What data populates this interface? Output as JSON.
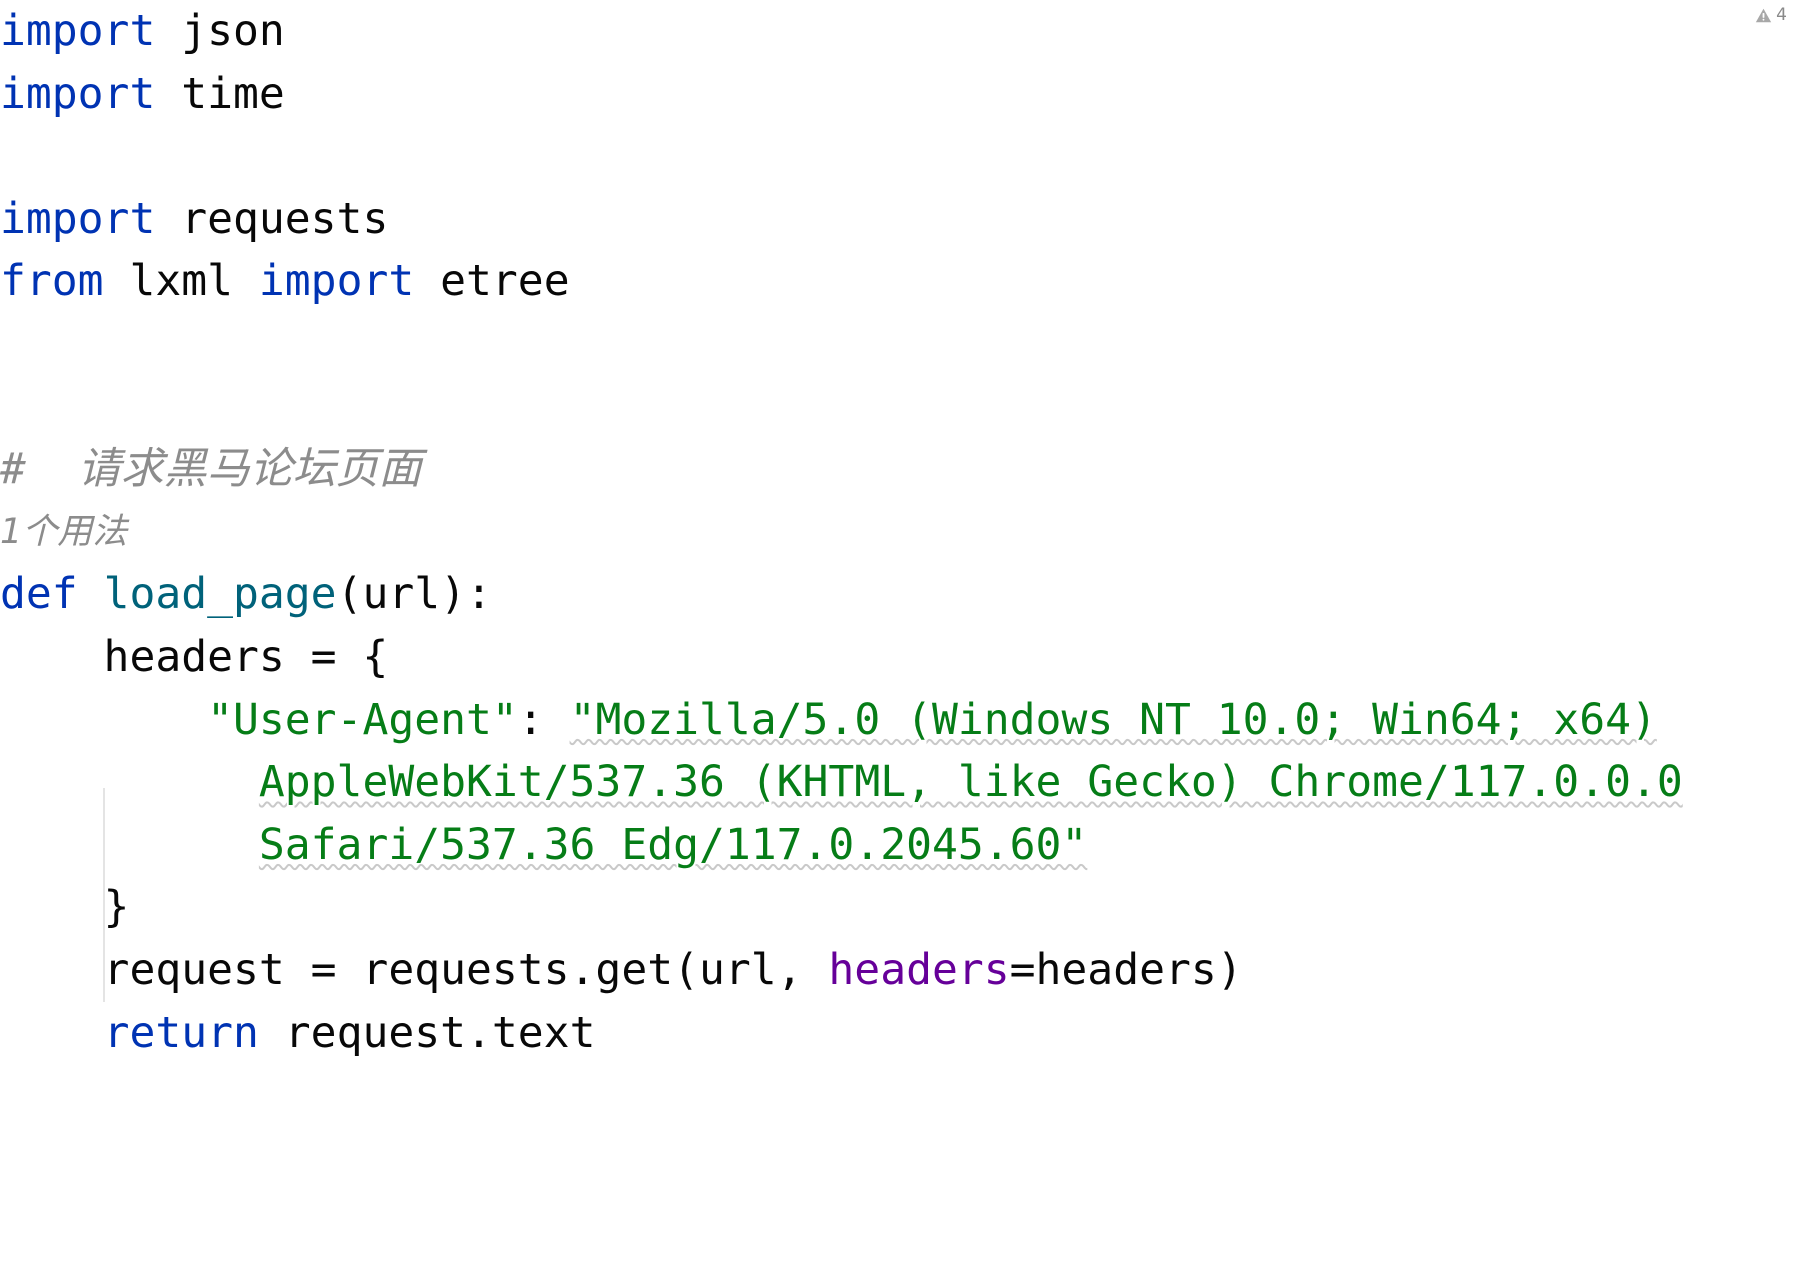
{
  "editor": {
    "language": "python",
    "background_color": "#ffffff",
    "font_size_px": 43
  },
  "inspection_widget": {
    "icon": "warning-triangle-icon",
    "icon_color": "#a6a6a6",
    "count": "4"
  },
  "syntax_colors": {
    "keyword": "#0033b3",
    "function_name": "#00627a",
    "string": "#067d17",
    "keyword_argument": "#660099",
    "plain_text": "#080808",
    "comment": "#8c8c8c",
    "code_lens": "#8c8c8c",
    "indent_guide": "#e4e4e4",
    "squiggle": "#c9c9c9"
  },
  "code_lens": {
    "usages_label": "1个用法"
  },
  "lines": {
    "l1_kw": "import",
    "l1_rest": " json",
    "l2_kw": "import",
    "l2_rest": " time",
    "l3": "",
    "l4_kw": "import",
    "l4_rest": " requests",
    "l5_kw_from": "from",
    "l5_mod": " lxml ",
    "l5_kw_import": "import",
    "l5_rest": " etree",
    "l6": "",
    "l7": "",
    "l8_comment": "#  请求黑马论坛页面",
    "l9_kw": "def",
    "l9_space": " ",
    "l9_fn": "load_page",
    "l9_rest": "(url):",
    "l10": "    headers = {",
    "l11_indent": "        ",
    "l11_key": "\"User-Agent\"",
    "l11_colon": ": ",
    "l11_val": "\"Mozilla/5.0 (Windows NT 10.0; Win64; x64)",
    "l12_indent": "          ",
    "l12_val": "AppleWebKit/537.36 (KHTML, like Gecko) Chrome/117.0.0.0",
    "l13_indent": "          ",
    "l13_val": "Safari/537.36 Edg/117.0.2045.60\"",
    "l14": "    }",
    "l15_pre": "    request = requests.get(url, ",
    "l15_kwarg": "headers",
    "l15_post": "=headers)",
    "l16_indent": "    ",
    "l16_kw": "return",
    "l16_rest": " request.text"
  }
}
